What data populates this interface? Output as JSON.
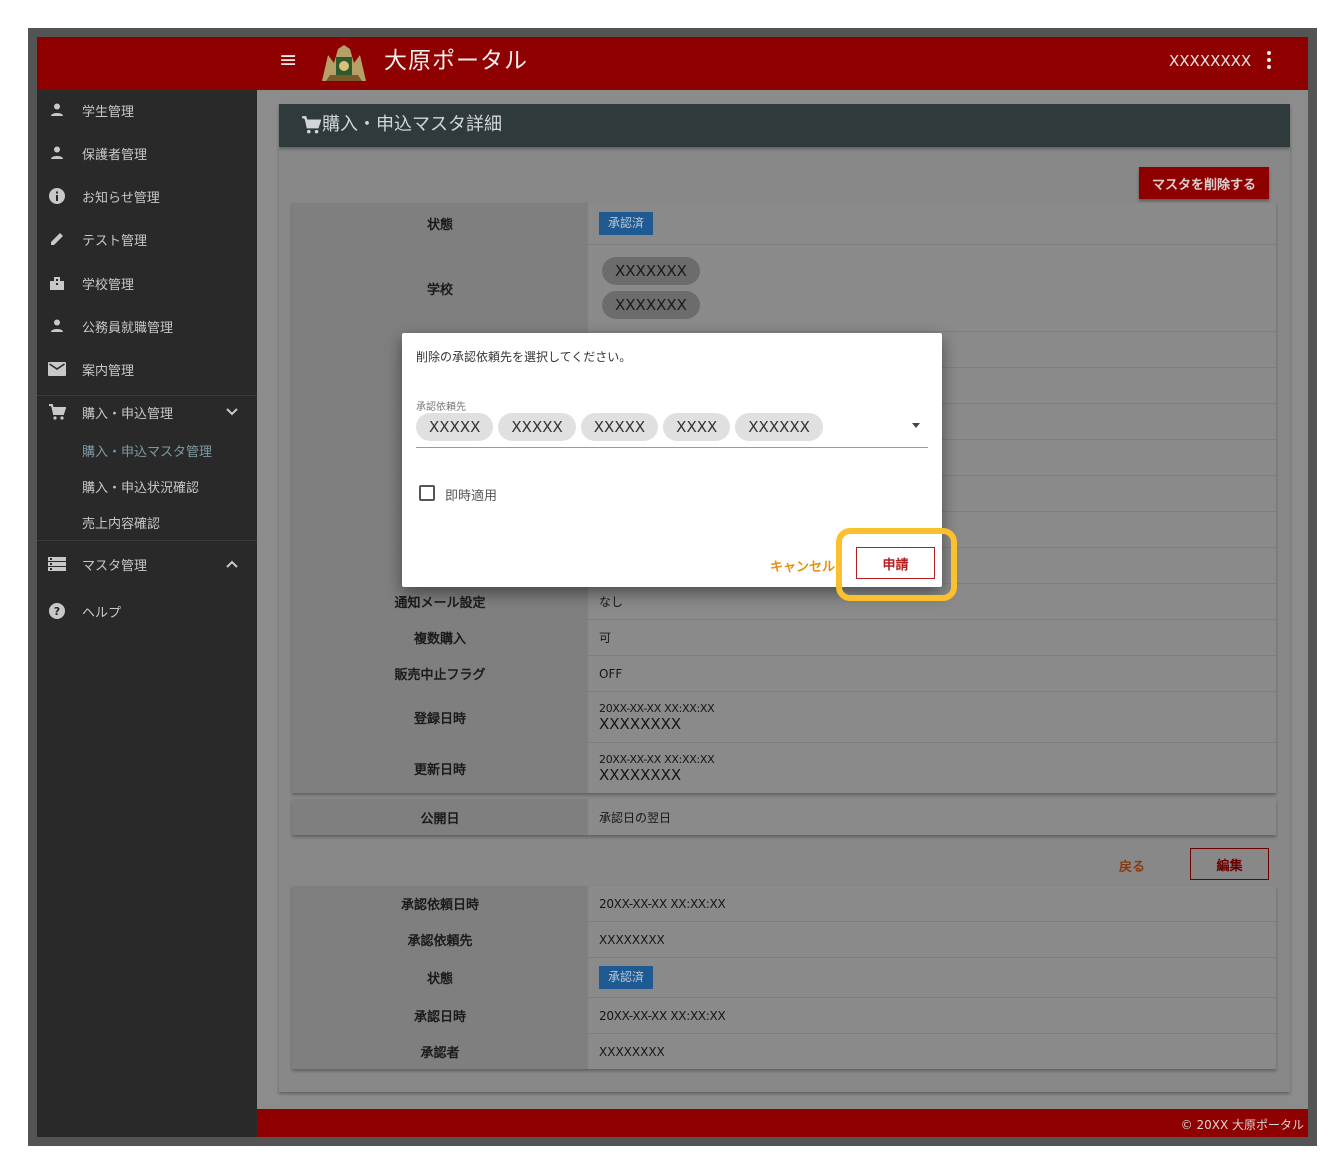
{
  "header": {
    "app_title": "大原ポータル",
    "user_name": "XXXXXXXX",
    "brand_color": "#8f0000"
  },
  "sidebar": {
    "items": [
      {
        "label": "学生管理",
        "icon": "person-icon"
      },
      {
        "label": "保護者管理",
        "icon": "person-icon"
      },
      {
        "label": "お知らせ管理",
        "icon": "info-icon"
      },
      {
        "label": "テスト管理",
        "icon": "pencil-icon"
      },
      {
        "label": "学校管理",
        "icon": "building-icon"
      },
      {
        "label": "公務員就職管理",
        "icon": "person-icon"
      },
      {
        "label": "案内管理",
        "icon": "mail-icon"
      },
      {
        "label": "購入・申込管理",
        "icon": "cart-icon"
      },
      {
        "label": "マスタ管理",
        "icon": "list-icon"
      },
      {
        "label": "ヘルプ",
        "icon": "help-icon"
      }
    ],
    "sub_items": [
      "購入・申込マスタ管理",
      "購入・申込状況確認",
      "売上内容確認"
    ]
  },
  "page": {
    "title": "購入・申込マスタ詳細",
    "delete_button": "マスタを削除する",
    "back_button": "戻る",
    "edit_button": "編集"
  },
  "detail": {
    "status_label": "状態",
    "status_value": "承認済",
    "school_label": "学校",
    "schools": [
      "XXXXXXX",
      "XXXXXXX"
    ],
    "notify_label": "通知メール設定",
    "notify_value": "なし",
    "multi_label": "複数購入",
    "multi_value": "可",
    "stop_label": "販売中止フラグ",
    "stop_value": "OFF",
    "created_label": "登録日時",
    "created_date": "20XX-XX-XX XX:XX:XX",
    "created_by": "XXXXXXXX",
    "updated_label": "更新日時",
    "updated_date": "20XX-XX-XX XX:XX:XX",
    "updated_by": "XXXXXXXX"
  },
  "publish": {
    "label": "公開日",
    "value": "承認日の翌日"
  },
  "approval": {
    "requested_at_label": "承認依頼日時",
    "requested_at": "20XX-XX-XX XX:XX:XX",
    "requested_to_label": "承認依頼先",
    "requested_to": "XXXXXXXX",
    "status_label": "状態",
    "status_value": "承認済",
    "approved_at_label": "承認日時",
    "approved_at": "20XX-XX-XX XX:XX:XX",
    "approver_label": "承認者",
    "approver": "XXXXXXXX"
  },
  "dialog": {
    "title": "削除の承認依頼先を選択してください。",
    "field_label": "承認依頼先",
    "selected": [
      "XXXXX",
      "XXXXX",
      "XXXXX",
      "XXXX",
      "XXXXXX"
    ],
    "checkbox_label": "即時適用",
    "checkbox_checked": false,
    "cancel": "キャンセル",
    "apply": "申請"
  },
  "footer": {
    "copyright": "© 20XX 大原ポータル"
  }
}
